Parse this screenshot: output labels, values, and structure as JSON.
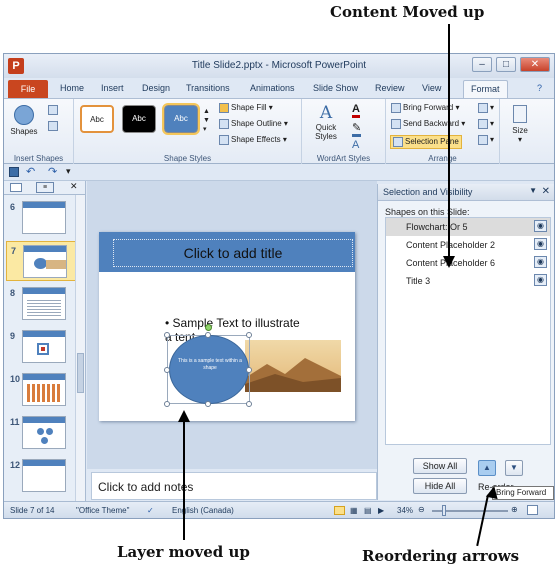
{
  "annotations": {
    "top": "Content Moved up",
    "bottom_left": "Layer moved up",
    "bottom_right": "Reordering arrows"
  },
  "window": {
    "title": "Title Slide2.pptx - Microsoft PowerPoint",
    "app_icon": "P"
  },
  "ribbon_tabs": [
    "File",
    "Home",
    "Insert",
    "Design",
    "Transitions",
    "Animations",
    "Slide Show",
    "Review",
    "View",
    "Format"
  ],
  "active_tab": "Format",
  "ribbon": {
    "insert_shapes": {
      "shapes_label": "Shapes",
      "group_label": "Insert Shapes"
    },
    "shape_styles": {
      "swatches": [
        "Abc",
        "Abc",
        "Abc"
      ],
      "fill": "Shape Fill",
      "outline": "Shape Outline",
      "effects": "Shape Effects",
      "group_label": "Shape Styles"
    },
    "wordart": {
      "quick_styles": "Quick Styles",
      "group_label": "WordArt Styles"
    },
    "arrange": {
      "bring_forward": "Bring Forward",
      "send_backward": "Send Backward",
      "selection_pane": "Selection Pane",
      "group_label": "Arrange"
    },
    "size": {
      "label": "Size"
    }
  },
  "thumbnails": [
    {
      "num": "6",
      "active": false
    },
    {
      "num": "7",
      "active": true
    },
    {
      "num": "8",
      "active": false
    },
    {
      "num": "9",
      "active": false
    },
    {
      "num": "10",
      "active": false
    },
    {
      "num": "11",
      "active": false
    },
    {
      "num": "12",
      "active": false
    }
  ],
  "slide": {
    "title_placeholder": "Click to add title",
    "bullet_line1": "• Sample  Text to illustrate",
    "bullet_line2": "a         tent",
    "shape_text": "This is a sample text within a shape"
  },
  "notes_placeholder": "Click to add notes",
  "selection_pane": {
    "title": "Selection and Visibility",
    "subtitle": "Shapes on this Slide:",
    "items": [
      {
        "label": "Flowchart: Or 5",
        "selected": true
      },
      {
        "label": "Content Placeholder 2",
        "selected": false
      },
      {
        "label": "Content Placeholder 6",
        "selected": false
      },
      {
        "label": "Title 3",
        "selected": false
      }
    ],
    "show_all": "Show All",
    "hide_all": "Hide All",
    "reorder_label": "Re-order",
    "tooltip": "Bring Forward"
  },
  "status": {
    "slide_info": "Slide 7 of 14",
    "theme": "\"Office Theme\"",
    "language": "English (Canada)",
    "zoom": "34%"
  }
}
